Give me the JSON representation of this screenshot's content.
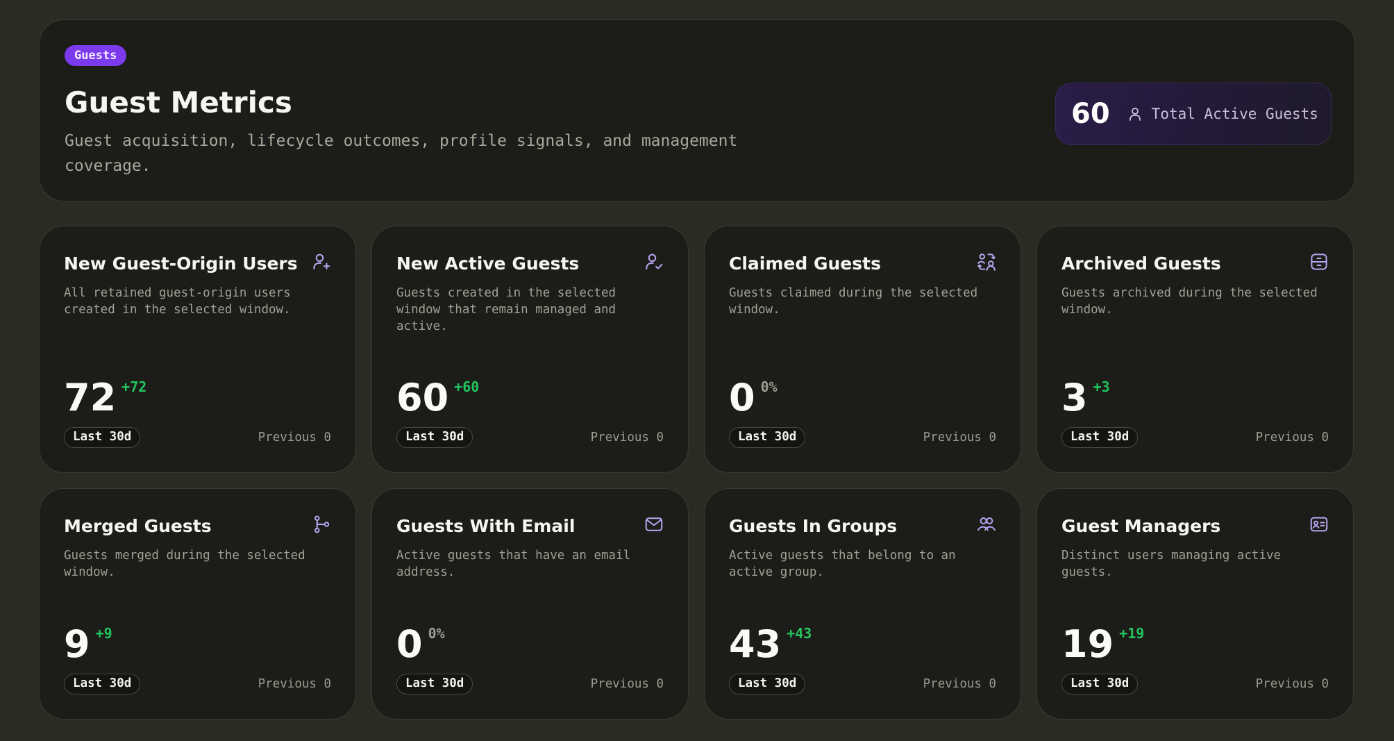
{
  "header": {
    "tag": "Guests",
    "title": "Guest Metrics",
    "subtitle": "Guest acquisition, lifecycle outcomes, profile signals, and management coverage.",
    "total": {
      "value": "60",
      "label": "Total Active Guests",
      "icon": "user-icon"
    }
  },
  "colors": {
    "accent": "#7c3aed",
    "positive": "#22c55e",
    "neutral": "#9b9b90",
    "icon": "#b8a6f2"
  },
  "cards": [
    {
      "title": "New Guest-Origin Users",
      "desc": "All retained guest-origin users created in the selected window.",
      "value": "72",
      "delta": "+72",
      "period": "Last 30d",
      "previous": "Previous 0",
      "icon": "user-plus-icon"
    },
    {
      "title": "New Active Guests",
      "desc": "Guests created in the selected window that remain managed and active.",
      "value": "60",
      "delta": "+60",
      "period": "Last 30d",
      "previous": "Previous 0",
      "icon": "user-check-icon"
    },
    {
      "title": "Claimed Guests",
      "desc": "Guests claimed during the selected window.",
      "value": "0",
      "delta": "0%",
      "period": "Last 30d",
      "previous": "Previous 0",
      "icon": "user-exchange-icon"
    },
    {
      "title": "Archived Guests",
      "desc": "Guests archived during the selected window.",
      "value": "3",
      "delta": "+3",
      "period": "Last 30d",
      "previous": "Previous 0",
      "icon": "archive-icon"
    },
    {
      "title": "Merged Guests",
      "desc": "Guests merged during the selected window.",
      "value": "9",
      "delta": "+9",
      "period": "Last 30d",
      "previous": "Previous 0",
      "icon": "merge-icon"
    },
    {
      "title": "Guests With Email",
      "desc": "Active guests that have an email address.",
      "value": "0",
      "delta": "0%",
      "period": "Last 30d",
      "previous": "Previous 0",
      "icon": "mail-icon"
    },
    {
      "title": "Guests In Groups",
      "desc": "Active guests that belong to an active group.",
      "value": "43",
      "delta": "+43",
      "period": "Last 30d",
      "previous": "Previous 0",
      "icon": "users-icon"
    },
    {
      "title": "Guest Managers",
      "desc": "Distinct users managing active guests.",
      "value": "19",
      "delta": "+19",
      "period": "Last 30d",
      "previous": "Previous 0",
      "icon": "id-card-icon"
    }
  ]
}
